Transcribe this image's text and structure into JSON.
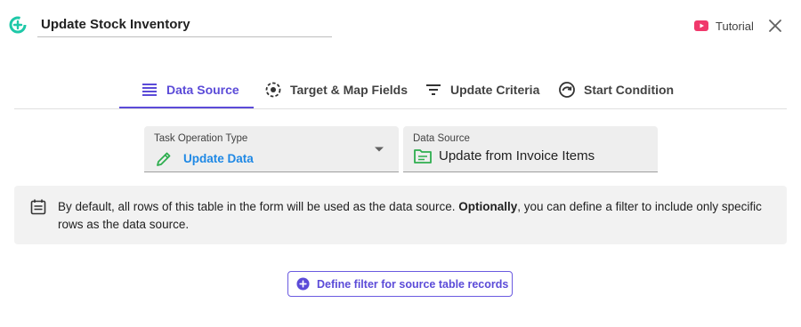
{
  "header": {
    "title": "Update Stock Inventory",
    "tutorial_label": "Tutorial"
  },
  "tabs": [
    {
      "label": "Data Source",
      "icon": "list-lines-icon",
      "active": true
    },
    {
      "label": "Target & Map Fields",
      "icon": "target-icon",
      "active": false
    },
    {
      "label": "Update Criteria",
      "icon": "filter-lines-icon",
      "active": false
    },
    {
      "label": "Start Condition",
      "icon": "clock-arrow-icon",
      "active": false
    }
  ],
  "operation_field": {
    "label": "Task Operation Type",
    "value": "Update Data",
    "icon": "pencil-icon"
  },
  "data_source_field": {
    "label": "Data Source",
    "value": "Update from Invoice Items",
    "icon": "table-icon"
  },
  "info": {
    "text_before": "By default, all rows of this table in the form will be used as the data source. ",
    "text_bold": "Optionally",
    "text_after": ", you can define a filter to include only specific rows as the data source.",
    "icon": "calendar-note-icon"
  },
  "filter_button": {
    "label": "Define filter for source table records",
    "icon": "plus-circle-icon"
  },
  "colors": {
    "accent": "#5b4bd8",
    "app_icon": "#1ec8a8",
    "value_blue": "#1e88e5",
    "pencil_green": "#2eae4f",
    "youtube_red": "#f0386b"
  }
}
